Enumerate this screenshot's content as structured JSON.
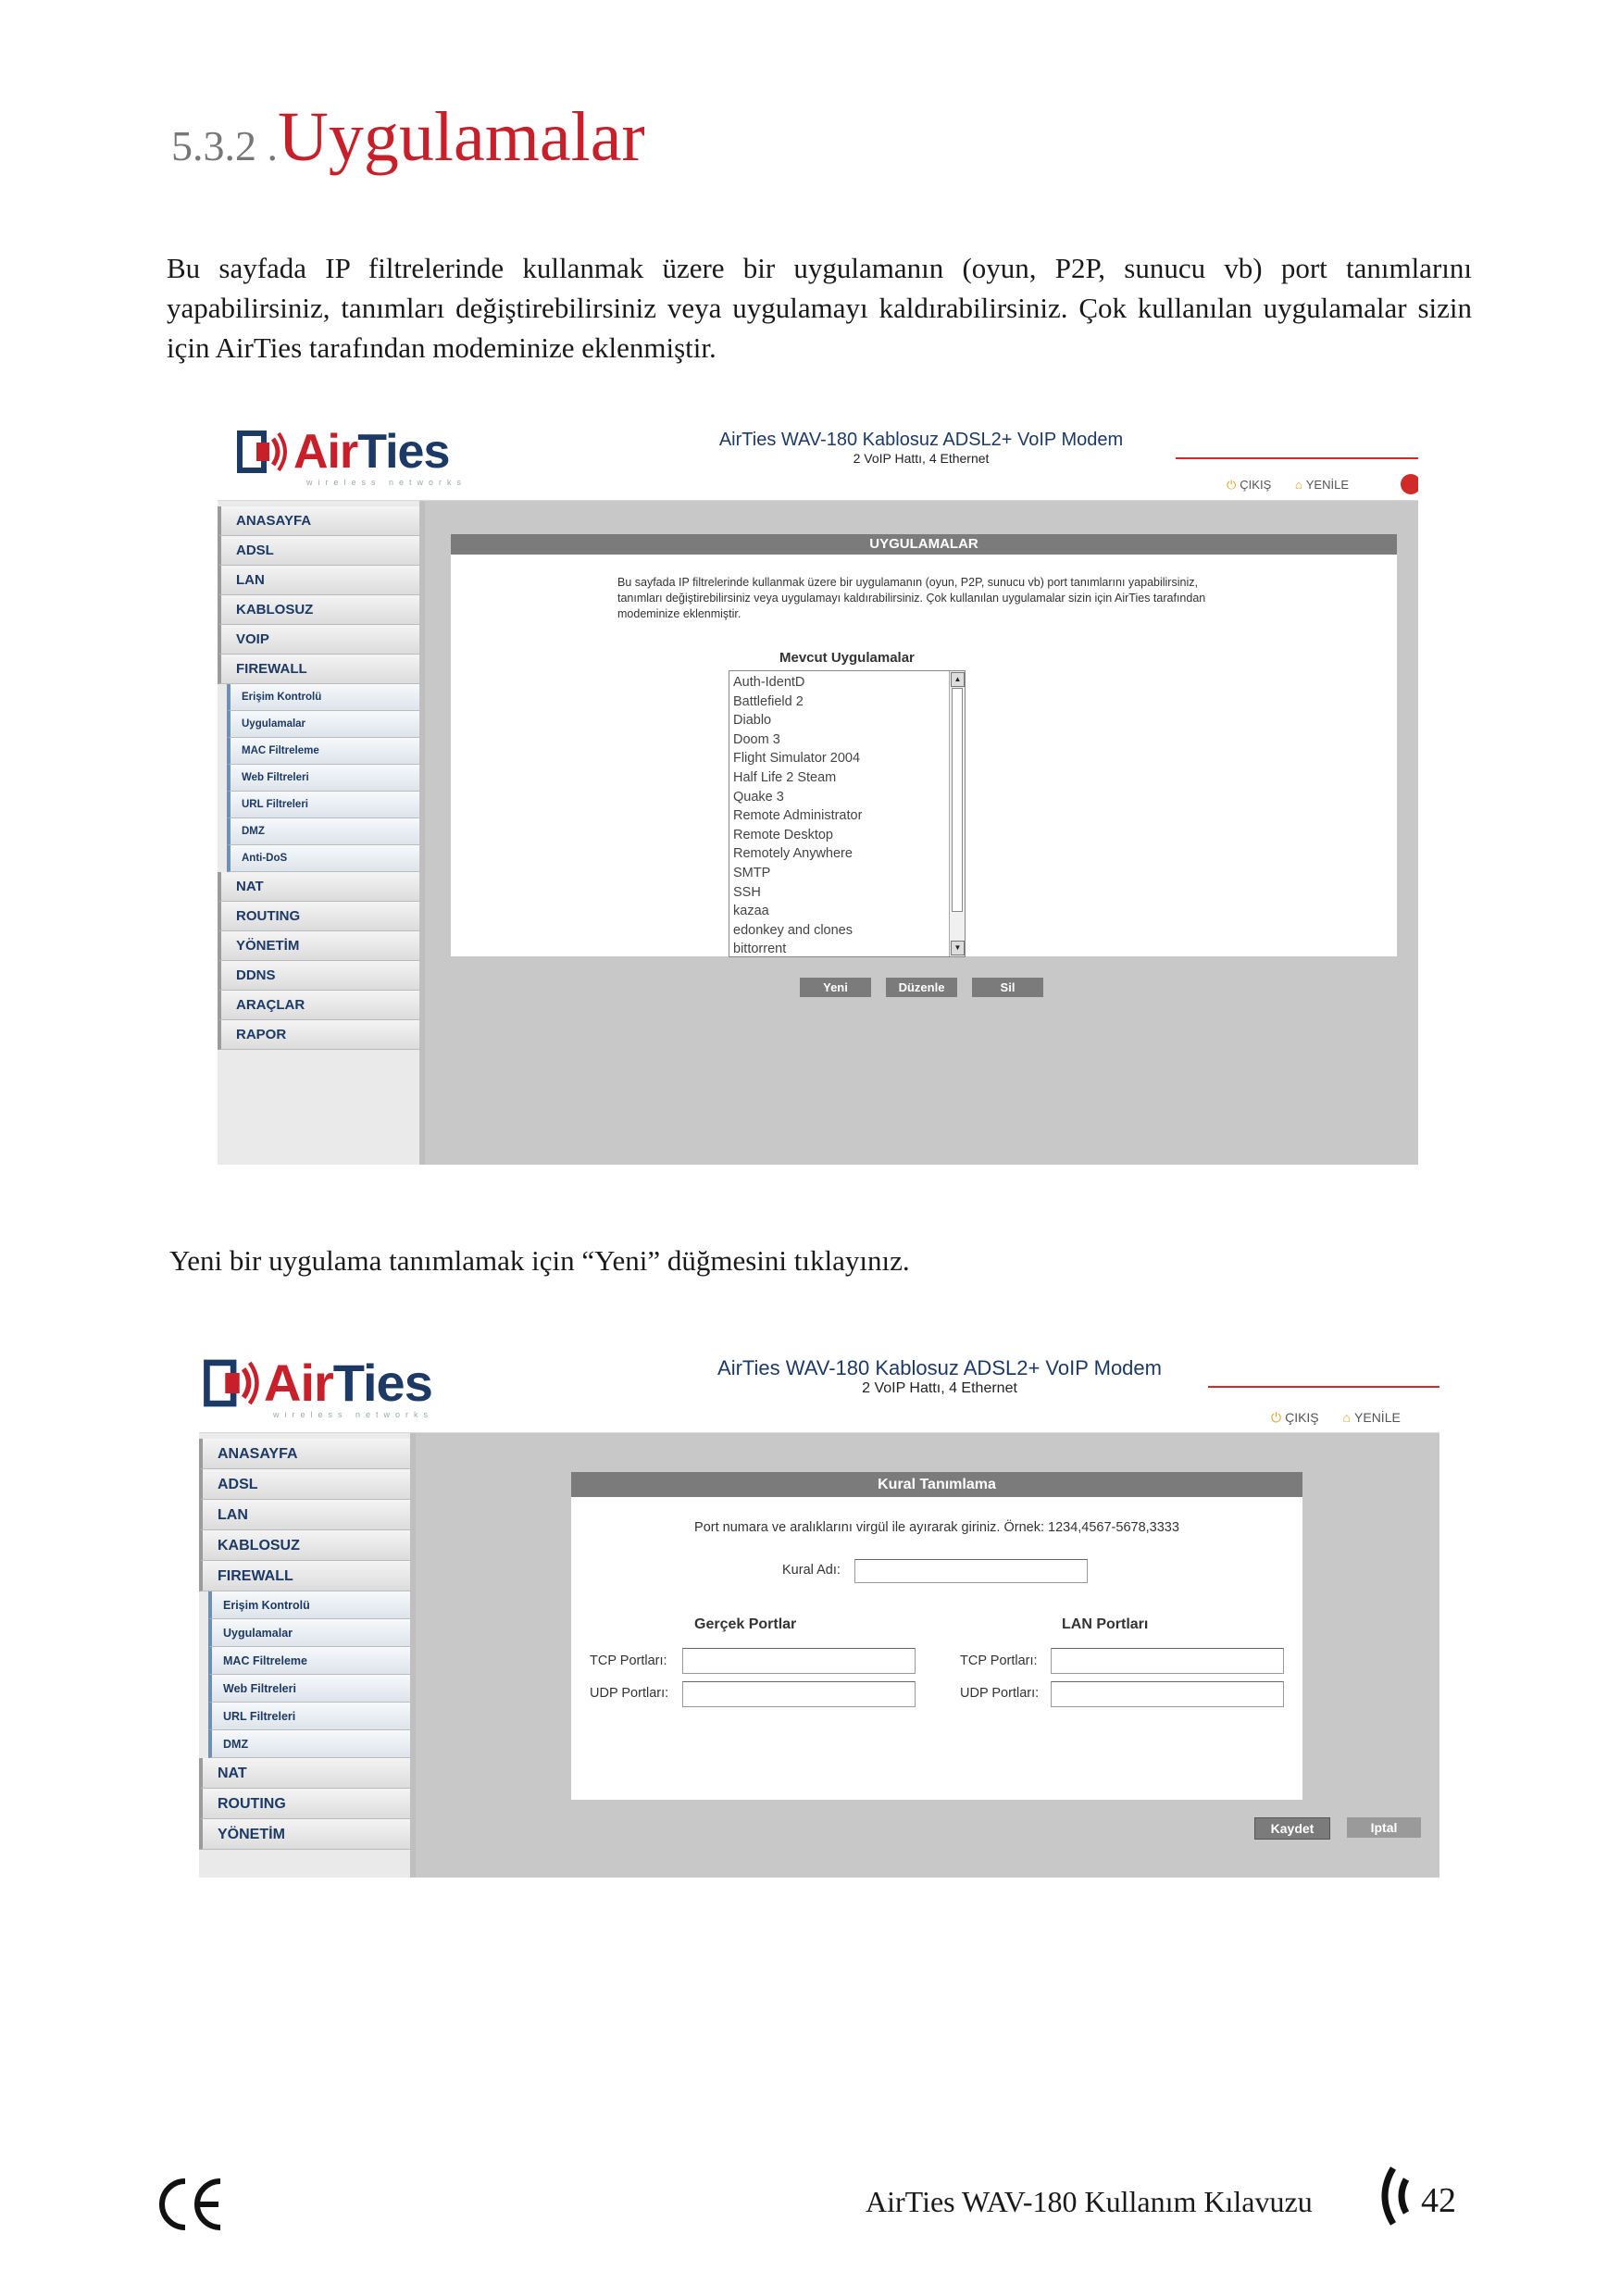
{
  "heading": {
    "number": "5.3.2 .",
    "title": "Uygulamalar"
  },
  "intro": "Bu sayfada IP filtrelerinde kullanmak üzere bir uygulamanın (oyun, P2P, sunucu vb) port tanımlarını yapabilirsiniz, tanımları değiştirebilirsiniz veya uygulamayı kaldırabilirsiniz. Çok kullanılan uygulamalar sizin için AirTies tarafından modeminize eklenmiştir.",
  "screenshot1": {
    "logo_air": "Air",
    "logo_ties": "Ties",
    "logo_sub": "wireless networks",
    "model_line1": "AirTies WAV-180 Kablosuz ADSL2+ VoIP Modem",
    "model_line2": "2 VoIP Hattı, 4 Ethernet",
    "header_links": [
      "ÇIKIŞ",
      "YENİLE"
    ],
    "nav": [
      {
        "label": "ANASAYFA",
        "sub": false
      },
      {
        "label": "ADSL",
        "sub": false
      },
      {
        "label": "LAN",
        "sub": false
      },
      {
        "label": "KABLOSUZ",
        "sub": false
      },
      {
        "label": "VOIP",
        "sub": false
      },
      {
        "label": "FIREWALL",
        "sub": false
      },
      {
        "label": "Erişim Kontrolü",
        "sub": true
      },
      {
        "label": "Uygulamalar",
        "sub": true
      },
      {
        "label": "MAC Filtreleme",
        "sub": true
      },
      {
        "label": "Web Filtreleri",
        "sub": true
      },
      {
        "label": "URL Filtreleri",
        "sub": true
      },
      {
        "label": "DMZ",
        "sub": true
      },
      {
        "label": "Anti-DoS",
        "sub": true
      },
      {
        "label": "NAT",
        "sub": false
      },
      {
        "label": "ROUTING",
        "sub": false
      },
      {
        "label": "YÖNETİM",
        "sub": false
      },
      {
        "label": "DDNS",
        "sub": false
      },
      {
        "label": "ARAÇLAR",
        "sub": false
      },
      {
        "label": "RAPOR",
        "sub": false
      }
    ],
    "panel_title": "UYGULAMALAR",
    "panel_desc": "Bu sayfada IP filtrelerinde kullanmak üzere bir uygulamanın (oyun, P2P, sunucu vb) port tanımlarını yapabilirsiniz, tanımları değiştirebilirsiniz veya uygulamayı kaldırabilirsiniz. Çok kullanılan uygulamalar sizin için AirTies tarafından modeminize eklenmiştir.",
    "list_title": "Mevcut Uygulamalar",
    "list_items": [
      "Auth-IdentD",
      "Battlefield 2",
      "Diablo",
      "Doom 3",
      "Flight Simulator 2004",
      "Half Life 2 Steam",
      "Quake 3",
      "Remote Administrator",
      "Remote Desktop",
      "Remotely Anywhere",
      "SMTP",
      "SSH",
      "kazaa",
      "edonkey and clones",
      "bittorrent"
    ],
    "buttons": [
      "Yeni",
      "Düzenle",
      "Sil"
    ]
  },
  "caption": "Yeni bir uygulama tanımlamak için “Yeni” düğmesini tıklayınız.",
  "screenshot2": {
    "logo_air": "Air",
    "logo_ties": "Ties",
    "logo_sub": "wireless networks",
    "model_line1": "AirTies WAV-180 Kablosuz ADSL2+ VoIP Modem",
    "model_line2": "2 VoIP Hattı, 4 Ethernet",
    "header_links": [
      "ÇIKIŞ",
      "YENİLE"
    ],
    "nav": [
      {
        "label": "ANASAYFA",
        "sub": false
      },
      {
        "label": "ADSL",
        "sub": false
      },
      {
        "label": "LAN",
        "sub": false
      },
      {
        "label": "KABLOSUZ",
        "sub": false
      },
      {
        "label": "FIREWALL",
        "sub": false
      },
      {
        "label": "Erişim Kontrolü",
        "sub": true
      },
      {
        "label": "Uygulamalar",
        "sub": true
      },
      {
        "label": "MAC Filtreleme",
        "sub": true
      },
      {
        "label": "Web Filtreleri",
        "sub": true
      },
      {
        "label": "URL Filtreleri",
        "sub": true
      },
      {
        "label": "DMZ",
        "sub": true
      },
      {
        "label": "NAT",
        "sub": false
      },
      {
        "label": "ROUTING",
        "sub": false
      },
      {
        "label": "YÖNETİM",
        "sub": false
      }
    ],
    "panel_title": "Kural Tanımlama",
    "panel_desc": "Port numara ve aralıklarını virgül ile ayırarak giriniz. Örnek: 1234,4567-5678,3333",
    "rule_name_label": "Kural Adı:",
    "real_ports_title": "Gerçek Portlar",
    "lan_ports_title": "LAN Portları",
    "tcp_label": "TCP Portları:",
    "udp_label": "UDP Portları:",
    "save_label": "Kaydet",
    "cancel_label": "Iptal"
  },
  "footer": {
    "text": "AirTies WAV-180 Kullanım Kılavuzu",
    "page": "42",
    "ce_mark": "CE"
  }
}
